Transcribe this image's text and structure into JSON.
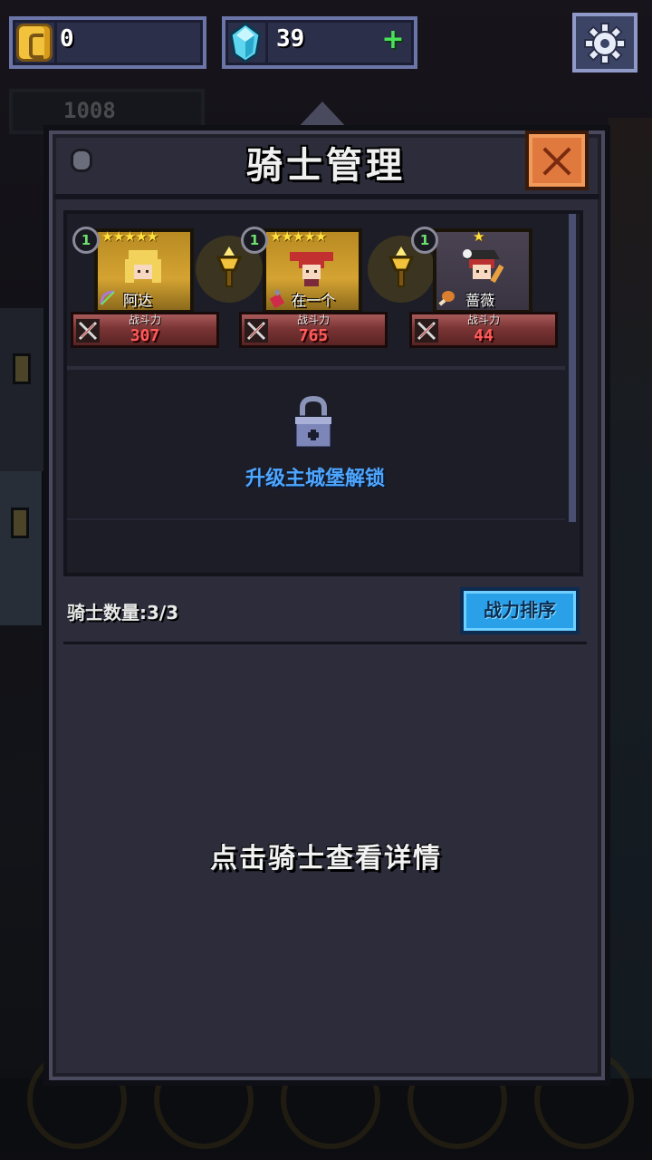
{
  "currency": {
    "gold": "0",
    "gems": "39",
    "add_gems_symbol": "+"
  },
  "background": {
    "power_total": "1008"
  },
  "panel": {
    "title": "骑士管理",
    "knights": [
      {
        "level": "1",
        "stars": "★★★★★",
        "name": "阿达",
        "power_label": "战斗力",
        "power": "307",
        "portrait": "gold"
      },
      {
        "level": "1",
        "stars": "★★★★★",
        "name": "在一个",
        "power_label": "战斗力",
        "power": "765",
        "portrait": "gold"
      },
      {
        "level": "1",
        "stars": "★",
        "name": "蔷薇",
        "power_label": "战斗力",
        "power": "44",
        "portrait": "plain"
      }
    ],
    "locked_slot_text": "升级主城堡解锁",
    "knight_count_label": "骑士数量:3/3",
    "sort_button_label": "战力排序",
    "detail_hint": "点击骑士查看详情"
  },
  "colors": {
    "panel_bg": "#2c2c3a",
    "accent_blue": "#2aa0e8",
    "close_orange": "#e0793e",
    "power_red": "#ff5a5a",
    "unlock_blue": "#4ea6ff",
    "star_yellow": "#ffe040"
  },
  "icons": {
    "gold": "coin-icon",
    "gem": "gem-icon",
    "settings": "gear-icon",
    "close": "close-icon",
    "lock": "lock-icon",
    "sword": "crossed-swords-icon",
    "torch": "torch-icon"
  }
}
